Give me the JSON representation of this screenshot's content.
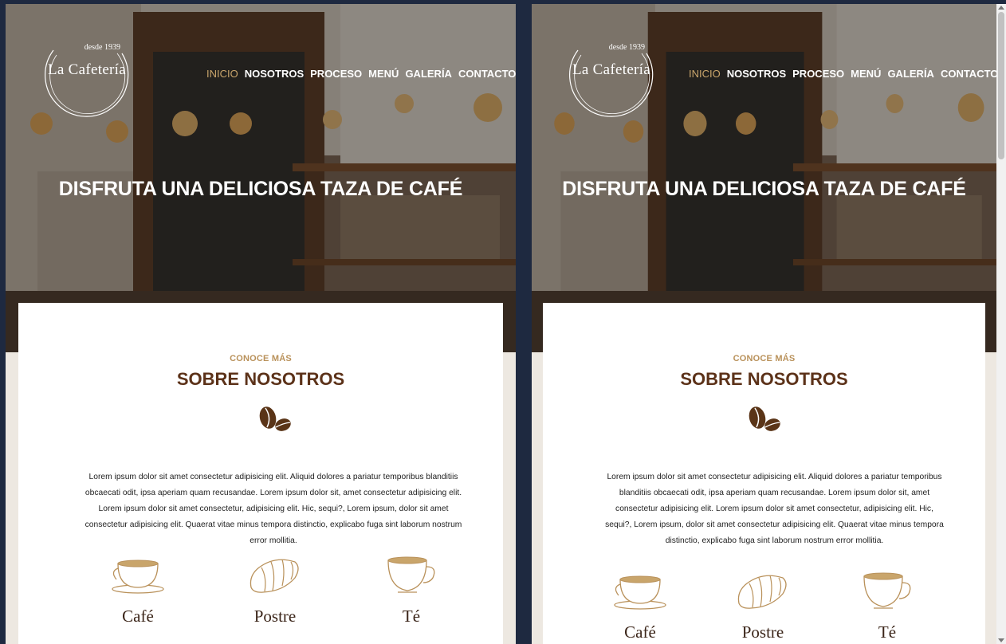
{
  "logo": {
    "since": "desde 1939",
    "brand": "La Cafetería"
  },
  "nav": [
    "INICIO",
    "NOSOTROS",
    "PROCESO",
    "MENÚ",
    "GALERÍA",
    "CONTACTO"
  ],
  "nav_active_index": 0,
  "hero": {
    "title": "DISFRUTA UNA DELICIOSA TAZA DE CAFÉ"
  },
  "about": {
    "eyebrow": "CONOCE MÁS",
    "title": "SOBRE NOSOTROS",
    "text": "Lorem ipsum dolor sit amet consectetur adipisicing elit. Aliquid dolores a pariatur temporibus blanditiis obcaecati odit, ipsa aperiam quam recusandae. Lorem ipsum dolor sit, amet consectetur adipisicing elit. Lorem ipsum dolor sit amet consectetur, adipisicing elit. Hic, sequi?, Lorem ipsum, dolor sit amet consectetur adipisicing elit. Quaerat vitae minus tempora distinctio, explicabo fuga sint laborum nostrum error mollitia."
  },
  "features": [
    {
      "label": "Café",
      "icon": "coffee-cup-icon"
    },
    {
      "label": "Postre",
      "icon": "croissant-icon"
    },
    {
      "label": "Té",
      "icon": "tea-cup-icon"
    }
  ],
  "colors": {
    "accent": "#c9a56b",
    "title": "#5c3219",
    "eyebrow": "#b9915a",
    "page_bg": "#ede8e1",
    "frame": "#1e2940"
  }
}
